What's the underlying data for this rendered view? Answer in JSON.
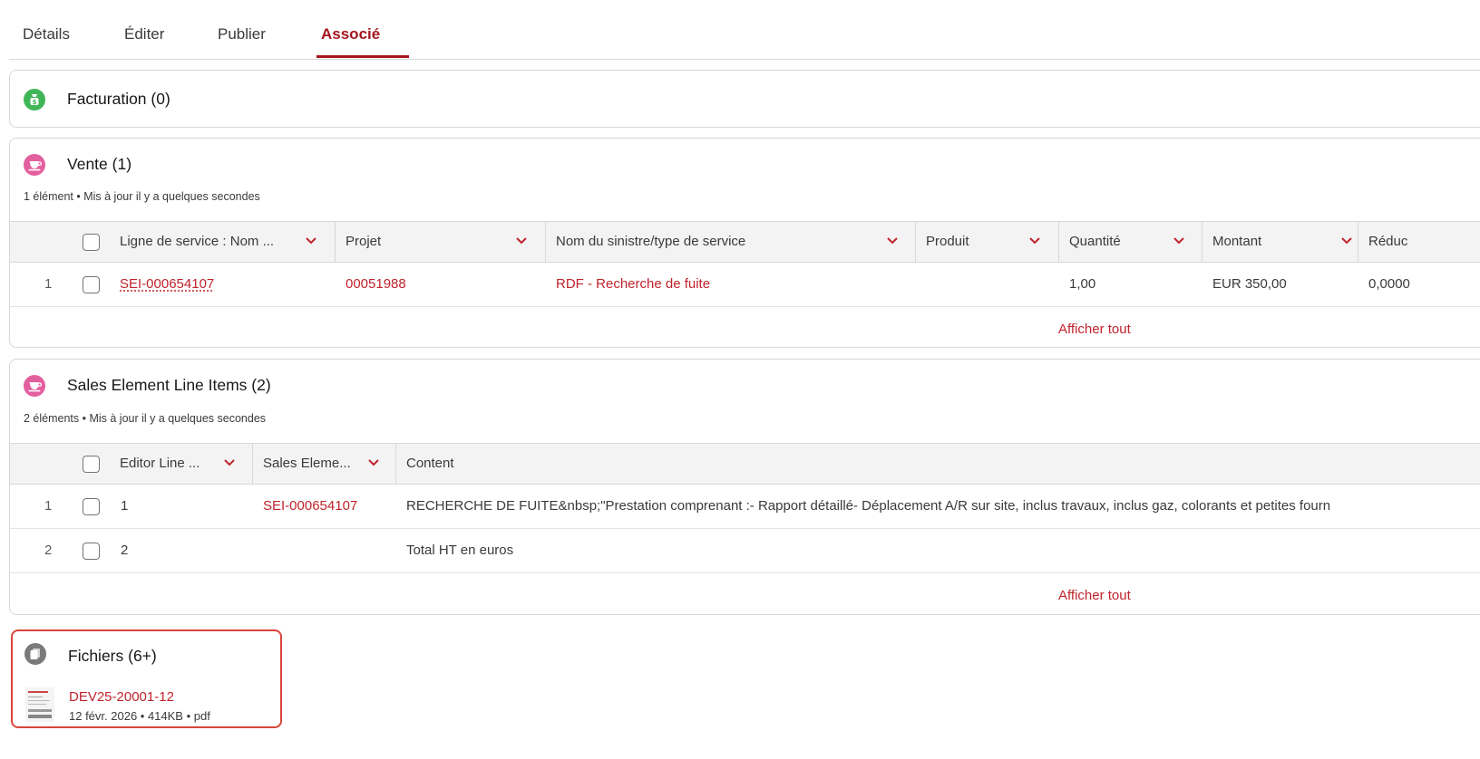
{
  "tabs": [
    {
      "label": "Détails"
    },
    {
      "label": "Éditer"
    },
    {
      "label": "Publier"
    },
    {
      "label": "Associé"
    }
  ],
  "facturation": {
    "title": "Facturation (0)",
    "icon": "money-bag-icon",
    "icon_color": "#41b658"
  },
  "vente": {
    "title": "Vente (1)",
    "icon": "cup-icon",
    "icon_color": "#e3609f",
    "subtitle": "1 élément • Mis à jour il y a quelques secondes",
    "columns": [
      "Ligne de service : Nom ...",
      "Projet",
      "Nom du sinistre/type de service",
      "Produit",
      "Quantité",
      "Montant",
      "Réduc"
    ],
    "rows": [
      {
        "index": "1",
        "ligne": "SEI-000654107",
        "projet": "00051988",
        "nom": "RDF - Recherche de fuite",
        "produit": "",
        "quantite": "1,00",
        "montant": "EUR 350,00",
        "reduc": "0,0000"
      }
    ],
    "show_all": "Afficher tout"
  },
  "sales": {
    "title": "Sales Element Line Items (2)",
    "icon": "cup-icon",
    "icon_color": "#e3609f",
    "subtitle": "2 éléments • Mis à jour il y a quelques secondes",
    "columns": [
      "Editor Line ...",
      "Sales Eleme...",
      "Content"
    ],
    "rows": [
      {
        "index": "1",
        "editor": "1",
        "sales": "SEI-000654107",
        "content": "RECHERCHE DE FUITE&nbsp;\"Prestation comprenant :- Rapport détaillé- Déplacement A/R sur site, inclus travaux, inclus gaz, colorants et petites fourn"
      },
      {
        "index": "2",
        "editor": "2",
        "sales": "",
        "content": "Total HT en euros"
      }
    ],
    "show_all": "Afficher tout"
  },
  "files": {
    "title": "Fichiers (6+)",
    "icon": "files-icon",
    "icon_color": "#7a7a7a",
    "items": [
      {
        "name": "DEV25-20001-12",
        "meta": "12 févr. 2026 • 414KB • pdf"
      }
    ]
  },
  "colors": {
    "accent": "#a5161f",
    "link": "#c0232c",
    "highlight_border": "#d9453a"
  }
}
